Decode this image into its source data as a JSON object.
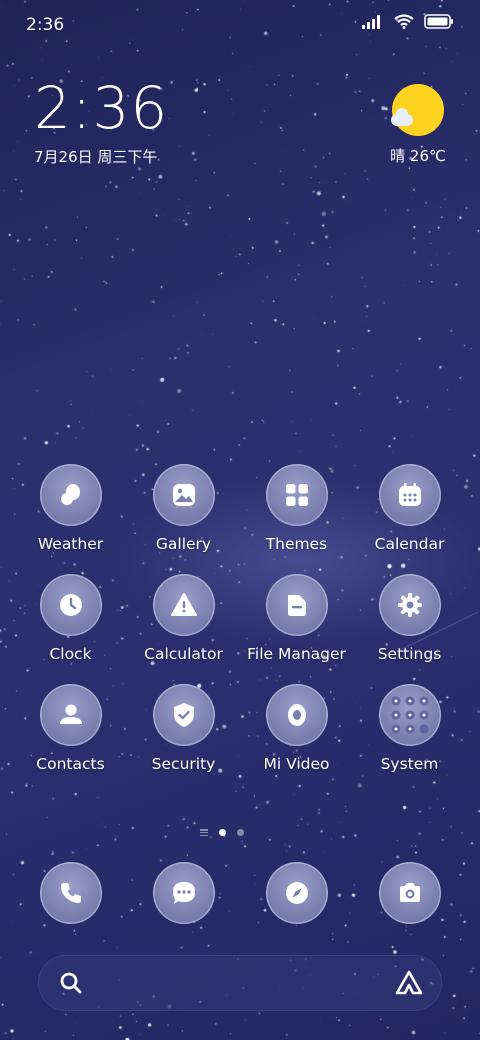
{
  "status_bar": {
    "time": "2:36",
    "icons": [
      "signal-icon",
      "wifi-icon",
      "battery-icon"
    ]
  },
  "clock_widget": {
    "time": "2:36",
    "date": "7月26日 周三下午"
  },
  "weather_widget": {
    "condition_icon": "sun-cloud-icon",
    "text": "晴 26℃"
  },
  "apps": [
    {
      "label": "Weather",
      "icon": "weather-icon"
    },
    {
      "label": "Gallery",
      "icon": "gallery-icon"
    },
    {
      "label": "Themes",
      "icon": "themes-icon"
    },
    {
      "label": "Calendar",
      "icon": "calendar-icon"
    },
    {
      "label": "Clock",
      "icon": "clock-icon"
    },
    {
      "label": "Calculator",
      "icon": "calculator-icon"
    },
    {
      "label": "File Manager",
      "icon": "file-manager-icon"
    },
    {
      "label": "Settings",
      "icon": "settings-icon"
    },
    {
      "label": "Contacts",
      "icon": "contacts-icon"
    },
    {
      "label": "Security",
      "icon": "security-icon"
    },
    {
      "label": "Mi Video",
      "icon": "mi-video-icon"
    },
    {
      "label": "System",
      "icon": "system-folder-icon"
    }
  ],
  "page_indicator": {
    "pages": 2,
    "active": 1
  },
  "dock": [
    {
      "icon": "phone-icon"
    },
    {
      "icon": "messages-icon"
    },
    {
      "icon": "browser-compass-icon"
    },
    {
      "icon": "camera-icon"
    }
  ],
  "search_bar": {
    "icons": [
      "search-icon",
      "assistant-icon"
    ]
  },
  "colors": {
    "background": "#2a2f6e",
    "sun": "#ffd21f",
    "icon_bg": "#7b7fb0"
  }
}
